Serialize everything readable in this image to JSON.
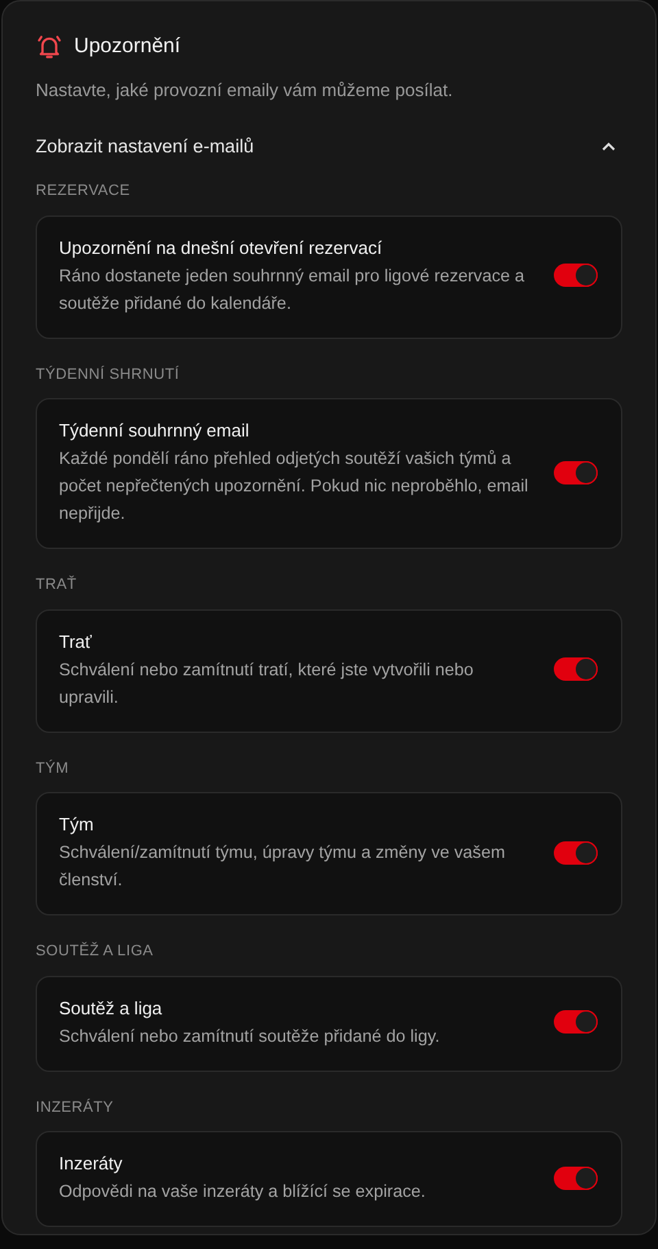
{
  "header": {
    "title": "Upozornění",
    "subtitle": "Nastavte, jaké provozní emaily vám můžeme posílat."
  },
  "expander": {
    "label": "Zobrazit nastavení e-mailů",
    "expanded": true
  },
  "sections": [
    {
      "label": "REZERVACE",
      "title": "Upozornění na dnešní otevření rezervací",
      "description": "Ráno dostanete jeden souhrnný email pro ligové rezervace a soutěže přidané do kalendáře.",
      "on": true
    },
    {
      "label": "TÝDENNÍ SHRNUTÍ",
      "title": "Týdenní souhrnný email",
      "description": "Každé pondělí ráno přehled odjetých soutěží vašich týmů a počet nepřečtených upozornění. Pokud nic neproběhlo, email nepřijde.",
      "on": true
    },
    {
      "label": "TRAŤ",
      "title": "Trať",
      "description": "Schválení nebo zamítnutí tratí, které jste vytvořili nebo upravili.",
      "on": true
    },
    {
      "label": "TÝM",
      "title": "Tým",
      "description": "Schválení/zamítnutí týmu, úpravy týmu a změny ve vašem členství.",
      "on": true
    },
    {
      "label": "SOUTĚŽ A LIGA",
      "title": "Soutěž a liga",
      "description": "Schválení nebo zamítnutí soutěže přidané do ligy.",
      "on": true
    },
    {
      "label": "INZERÁTY",
      "title": "Inzeráty",
      "description": "Odpovědi na vaše inzeráty a blížící se expirace.",
      "on": true
    }
  ]
}
